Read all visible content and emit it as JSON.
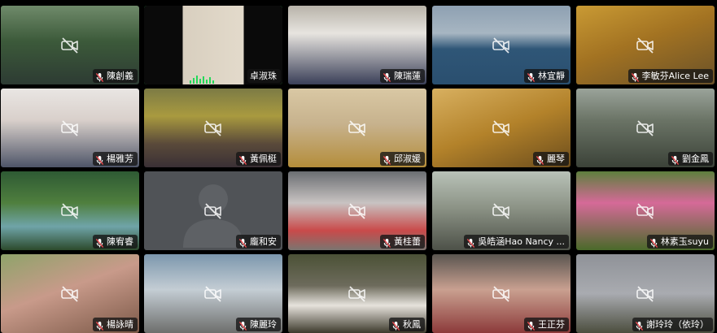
{
  "meeting": {
    "layout": "gallery-view",
    "accent_color": "#23d959",
    "name_tag_bg": "#141414",
    "muted_icon": "microphone-muted-icon",
    "camera_off_icon": "video-camera-off-icon"
  },
  "participants": [
    {
      "name": "陳創義",
      "muted": true,
      "camera_off": true,
      "active_speaker": false,
      "bg": "linear-gradient(180deg,#6f8a6a 0%,#3c5a3a 45%,#2d3b33 100%)"
    },
    {
      "name": "卓淑珠",
      "muted": false,
      "camera_off": false,
      "active_speaker": true,
      "bg": "linear-gradient(90deg,#0a0a0a 0%,#0a0a0a 28%,#d8cfbf 28%,#e3dacb 72%,#0a0a0a 72%,#0a0a0a 100%)"
    },
    {
      "name": "陳瑞蓮",
      "muted": true,
      "camera_off": false,
      "active_speaker": false,
      "bg": "linear-gradient(180deg,#b8b3a9 0%,#e7e4df 35%,#3a3f58 100%)"
    },
    {
      "name": "林宜靜",
      "muted": true,
      "camera_off": true,
      "active_speaker": false,
      "bg": "linear-gradient(180deg,#8ea0b2 0%,#a7b6c2 35%,#2f5677 55%,#2a4f6f 100%)"
    },
    {
      "name": "李敏芬Alice Lee",
      "muted": true,
      "camera_off": true,
      "active_speaker": false,
      "bg": "linear-gradient(160deg,#c99a34 0%,#a37322 45%,#6a5128 100%)"
    },
    {
      "name": "楊雅芳",
      "muted": true,
      "camera_off": true,
      "active_speaker": false,
      "bg": "linear-gradient(180deg,#e9e6e3 0%,#d9d0cb 40%,#4e5568 100%)"
    },
    {
      "name": "黃佩梃",
      "muted": true,
      "camera_off": true,
      "active_speaker": false,
      "bg": "linear-gradient(180deg,#7c7b45 0%,#a99a3f 35%,#5a4a3a 70%,#3a3035 100%)"
    },
    {
      "name": "邱淑媛",
      "muted": true,
      "camera_off": true,
      "active_speaker": false,
      "bg": "linear-gradient(180deg,#d9c8a4 0%,#c7b28d 45%,#b48d3a 100%)"
    },
    {
      "name": "麗琴",
      "muted": true,
      "camera_off": true,
      "active_speaker": false,
      "bg": "linear-gradient(160deg,#d8b060 0%,#b3822a 50%,#6c4d1c 100%)"
    },
    {
      "name": "劉金鳳",
      "muted": true,
      "camera_off": true,
      "active_speaker": false,
      "bg": "linear-gradient(180deg,#9aa39a 0%,#6b7466 40%,#3b4238 100%)"
    },
    {
      "name": "陳宥睿",
      "muted": true,
      "camera_off": true,
      "active_speaker": false,
      "bg": "linear-gradient(180deg,#2e5a34 0%,#4f7f3e 40%,#6fa4a8 70%,#2c4a2c 100%)"
    },
    {
      "name": "龐和安",
      "muted": true,
      "camera_off": true,
      "active_speaker": false,
      "bg": "#505357"
    },
    {
      "name": "黃桂蕾",
      "muted": true,
      "camera_off": true,
      "active_speaker": false,
      "bg": "linear-gradient(180deg,#6b6e72 0%,#c8c3c2 40%,#c94a4a 75%,#7a7570 100%)"
    },
    {
      "name": "吳皓涵Hao Nancy ...",
      "muted": true,
      "camera_off": true,
      "active_speaker": false,
      "bg": "linear-gradient(180deg,#b9c2b8 0%,#8d9487 45%,#4d5148 100%)"
    },
    {
      "name": "林素玉suyu",
      "muted": true,
      "camera_off": true,
      "active_speaker": false,
      "bg": "linear-gradient(180deg,#5d7f3d 0%,#d56a98 40%,#4a6a2a 100%)"
    },
    {
      "name": "楊詠晴",
      "muted": true,
      "camera_off": true,
      "active_speaker": false,
      "bg": "linear-gradient(160deg,#8fa36a 0%,#c89a8a 45%,#7c5948 100%)"
    },
    {
      "name": "陳麗玲",
      "muted": true,
      "camera_off": true,
      "active_speaker": false,
      "bg": "linear-gradient(180deg,#7c97ad 0%,#c4cdd4 45%,#6d6e6c 100%)"
    },
    {
      "name": "秋鳳",
      "muted": true,
      "camera_off": true,
      "active_speaker": false,
      "bg": "linear-gradient(180deg,#4b5136 0%,#6d6b5c 40%,#e6e2dc 65%,#3d3a2c 100%)"
    },
    {
      "name": "王正芬",
      "muted": true,
      "camera_off": true,
      "active_speaker": false,
      "bg": "linear-gradient(180deg,#5a5550 0%,#c9a090 45%,#8c3a3a 100%)"
    },
    {
      "name": "謝玲玲（依玲）",
      "muted": true,
      "camera_off": true,
      "active_speaker": false,
      "bg": "linear-gradient(180deg,#8f9298 0%,#a9abb0 50%,#4b4d3e 100%)"
    }
  ]
}
